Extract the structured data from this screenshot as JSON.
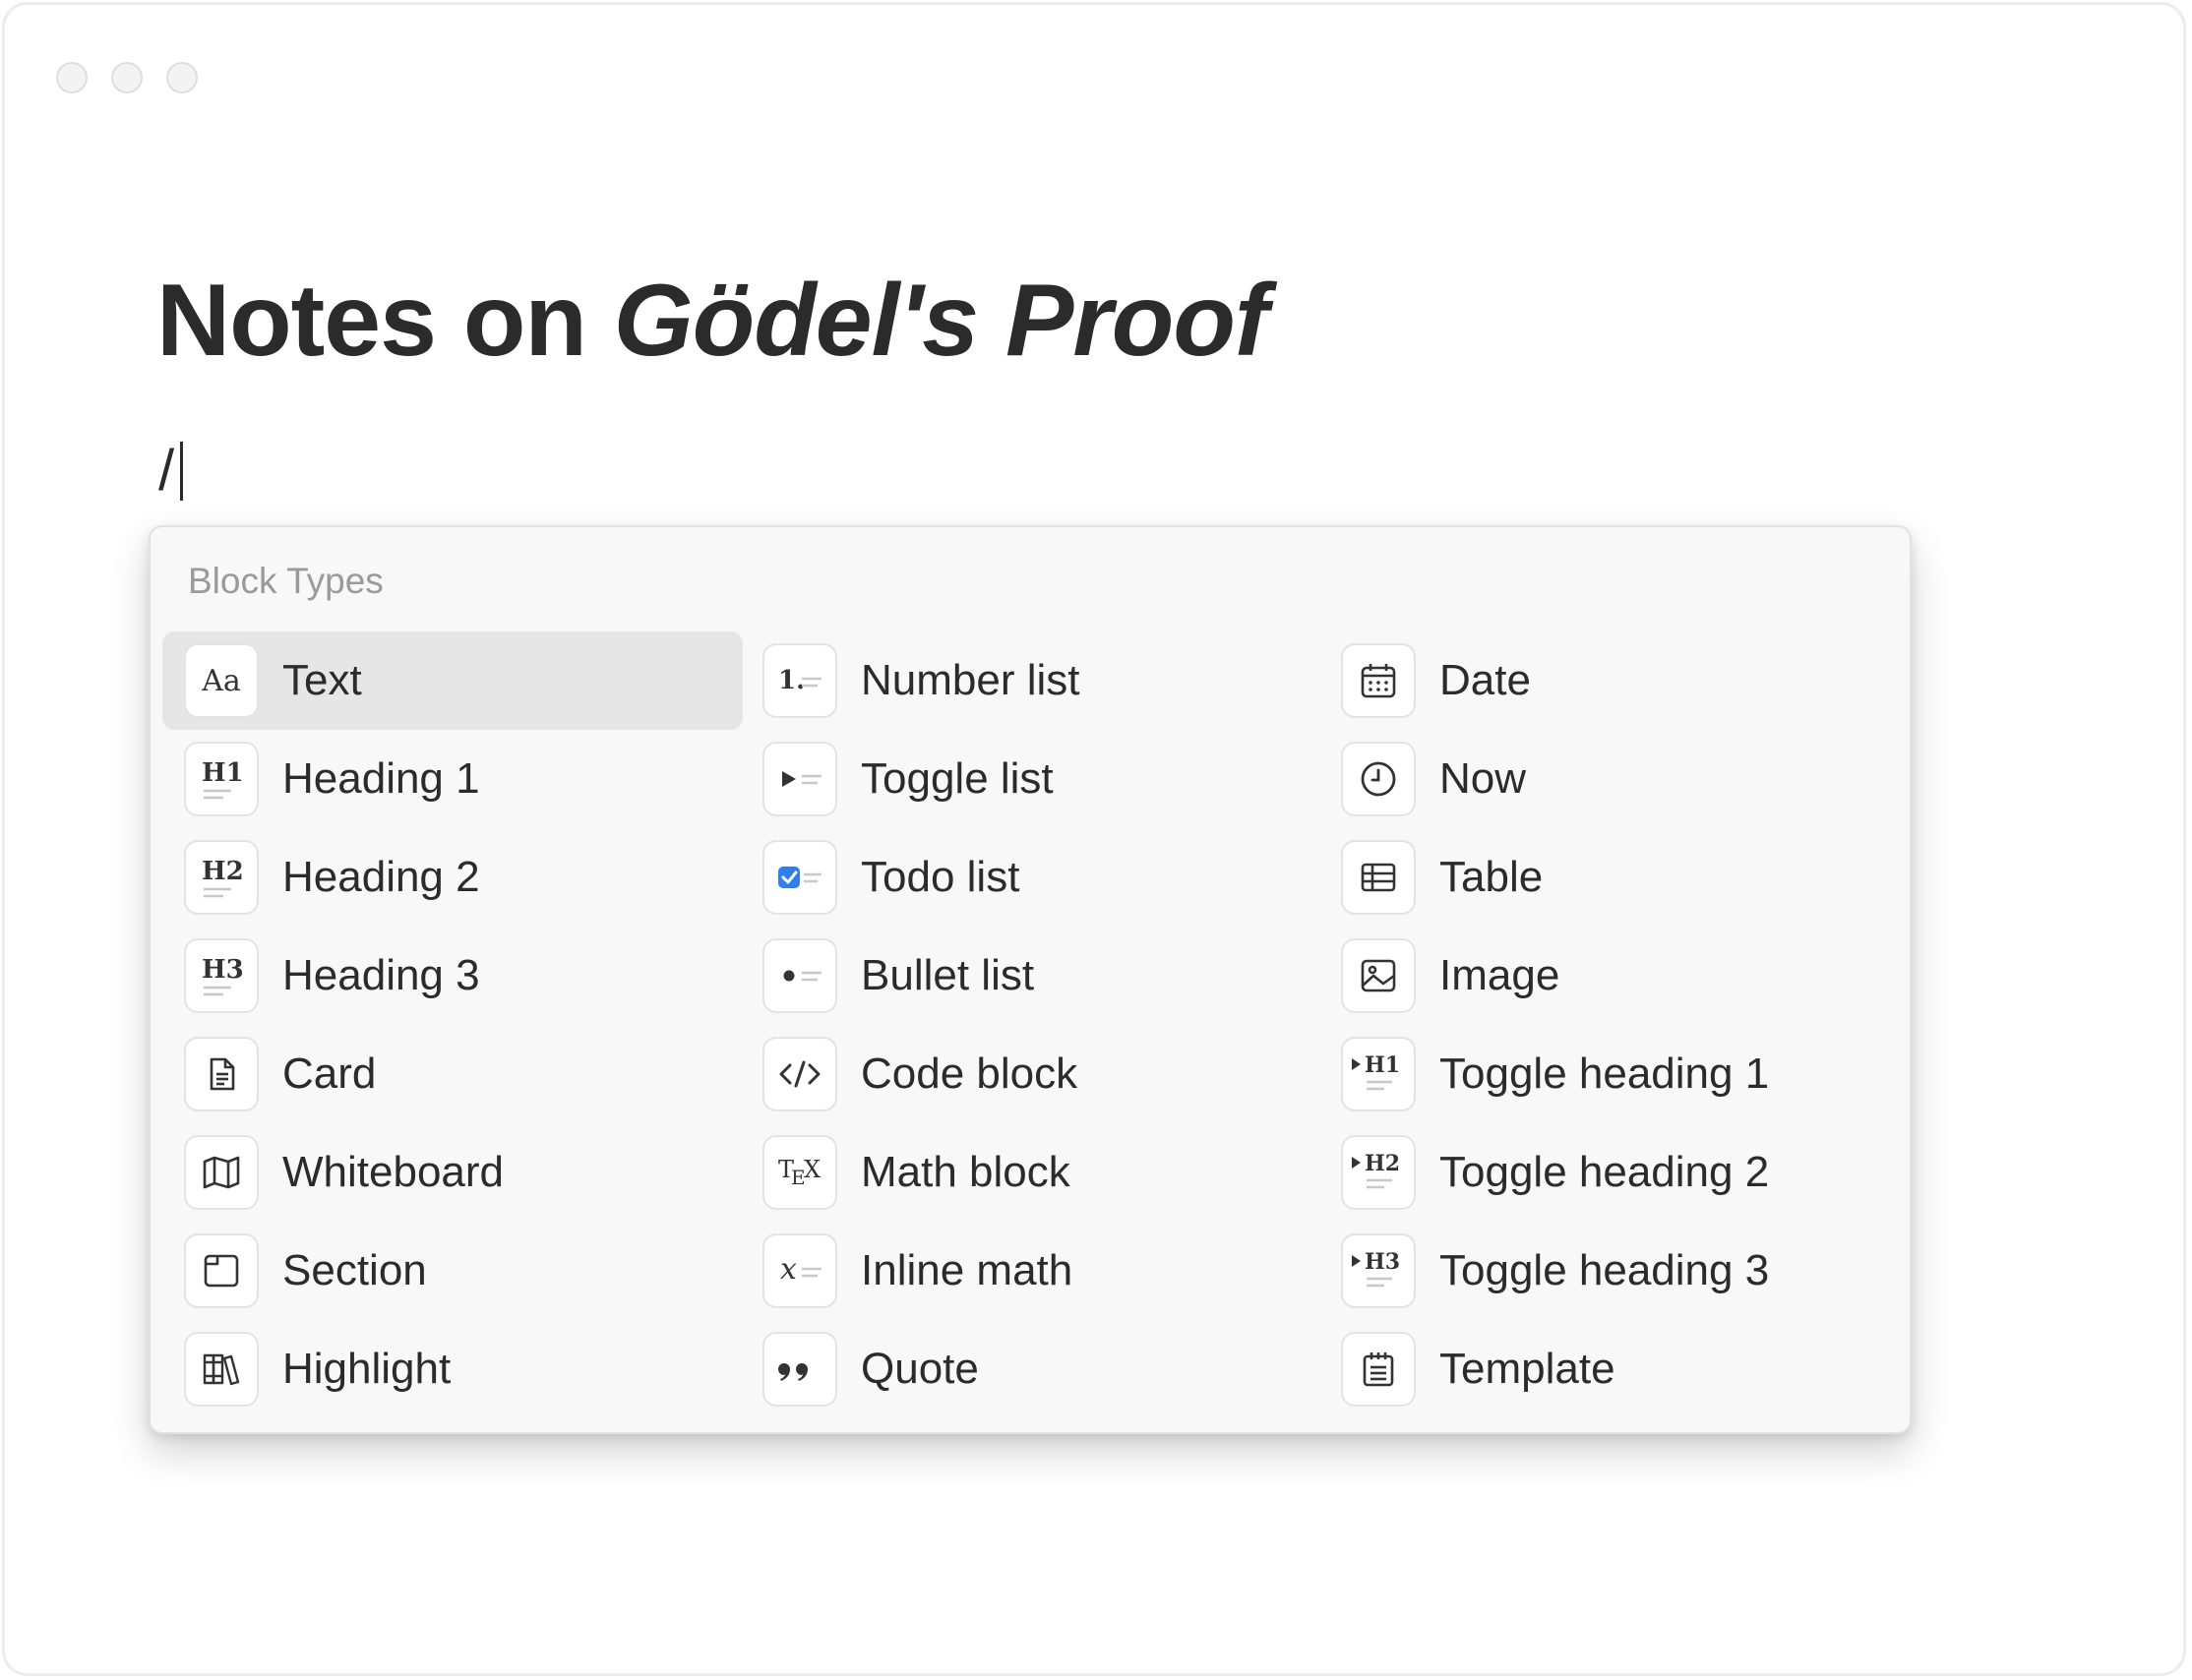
{
  "document": {
    "title_plain": "Notes on ",
    "title_italic": "Gödel's Proof",
    "input_text": "/"
  },
  "menu": {
    "heading": "Block Types",
    "columns": [
      [
        {
          "label": "Text",
          "icon": "text-icon",
          "glyph": "Aa"
        },
        {
          "label": "Heading 1",
          "icon": "heading-1-icon",
          "glyph": "H1"
        },
        {
          "label": "Heading 2",
          "icon": "heading-2-icon",
          "glyph": "H2"
        },
        {
          "label": "Heading 3",
          "icon": "heading-3-icon",
          "glyph": "H3"
        },
        {
          "label": "Card",
          "icon": "document-icon"
        },
        {
          "label": "Whiteboard",
          "icon": "map-icon"
        },
        {
          "label": "Section",
          "icon": "section-icon"
        },
        {
          "label": "Highlight",
          "icon": "books-icon"
        }
      ],
      [
        {
          "label": "Number list",
          "icon": "number-list-icon",
          "glyph": "1."
        },
        {
          "label": "Toggle list",
          "icon": "toggle-list-icon"
        },
        {
          "label": "Todo list",
          "icon": "todo-list-icon"
        },
        {
          "label": "Bullet list",
          "icon": "bullet-list-icon"
        },
        {
          "label": "Code block",
          "icon": "code-icon",
          "glyph": "</>"
        },
        {
          "label": "Math block",
          "icon": "tex-icon",
          "glyph": "TEX"
        },
        {
          "label": "Inline math",
          "icon": "inline-math-icon",
          "glyph": "x"
        },
        {
          "label": "Quote",
          "icon": "quote-icon",
          "glyph": "66"
        }
      ],
      [
        {
          "label": "Date",
          "icon": "calendar-icon"
        },
        {
          "label": "Now",
          "icon": "clock-icon"
        },
        {
          "label": "Table",
          "icon": "table-icon"
        },
        {
          "label": "Image",
          "icon": "image-icon"
        },
        {
          "label": "Toggle heading 1",
          "icon": "toggle-heading-1-icon",
          "glyph": "H1"
        },
        {
          "label": "Toggle heading 2",
          "icon": "toggle-heading-2-icon",
          "glyph": "H2"
        },
        {
          "label": "Toggle heading 3",
          "icon": "toggle-heading-3-icon",
          "glyph": "H3"
        },
        {
          "label": "Template",
          "icon": "template-icon"
        }
      ]
    ],
    "selected": "Text"
  },
  "colors": {
    "accent_checkbox": "#2f80ed",
    "selected_row": "#e6e6e6",
    "menu_bg": "#f8f8f8"
  }
}
